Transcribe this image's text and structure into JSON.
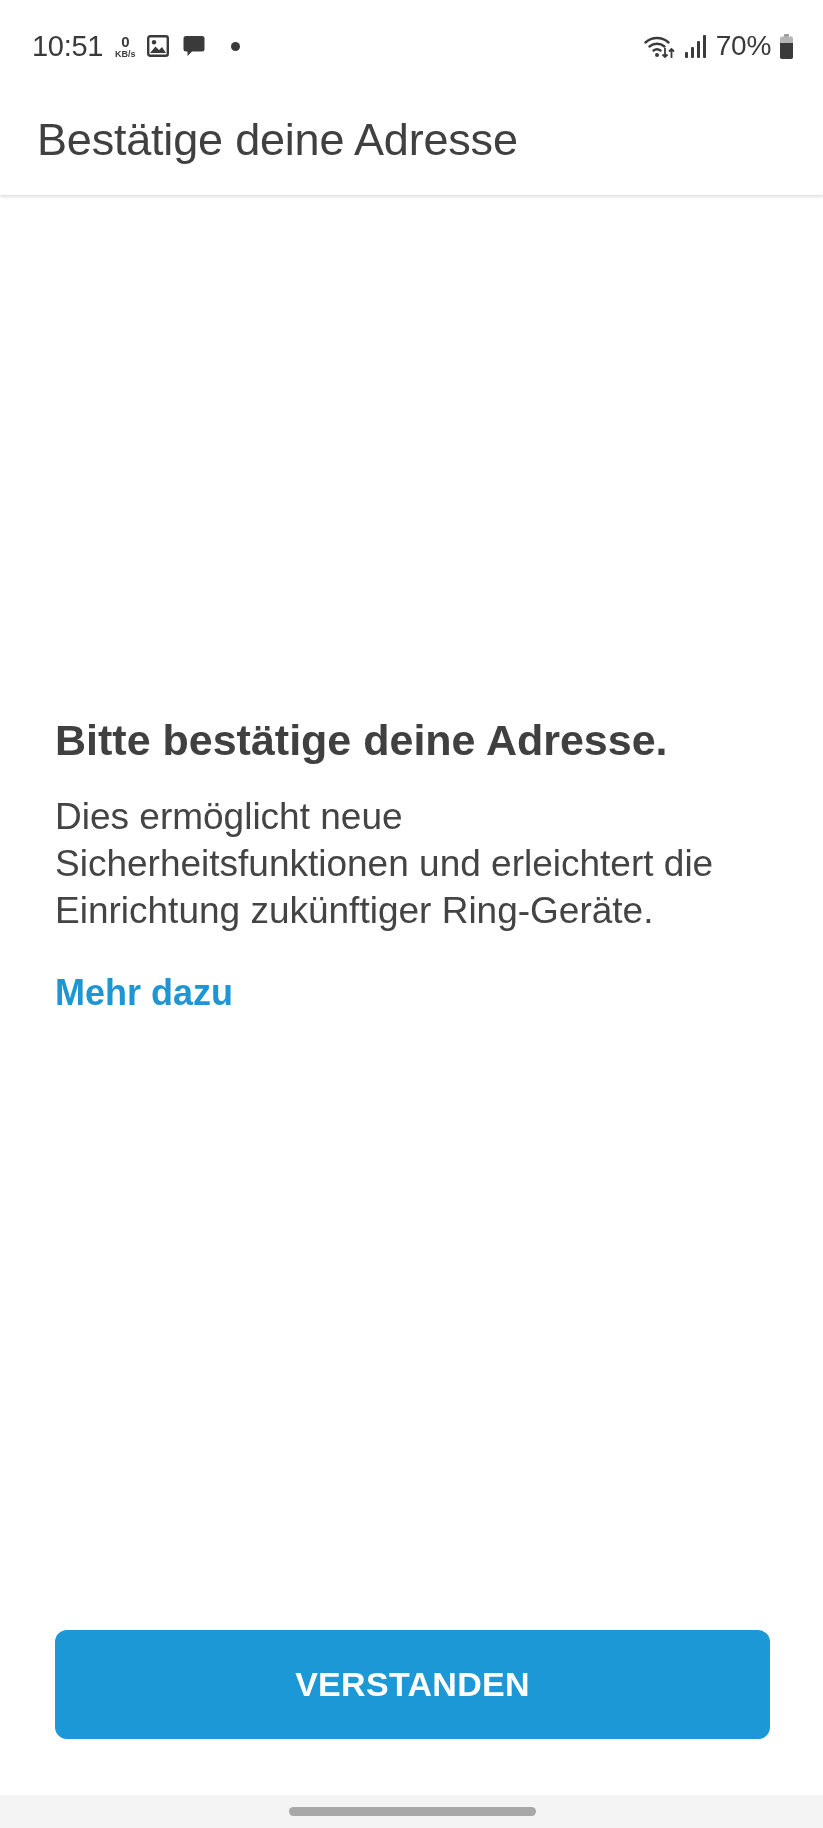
{
  "status_bar": {
    "time": "10:51",
    "network_speed": {
      "value": "0",
      "unit": "KB/s"
    },
    "battery_percent": "70%"
  },
  "app_bar": {
    "title": "Bestätige deine Adresse"
  },
  "content": {
    "heading": "Bitte bestätige deine Adresse.",
    "description": "Dies ermöglicht neue Sicherheitsfunktionen und erleichtert die Einrichtung zukünftiger Ring-Geräte.",
    "link": "Mehr dazu"
  },
  "primary_button": {
    "label": "VERSTANDEN"
  }
}
